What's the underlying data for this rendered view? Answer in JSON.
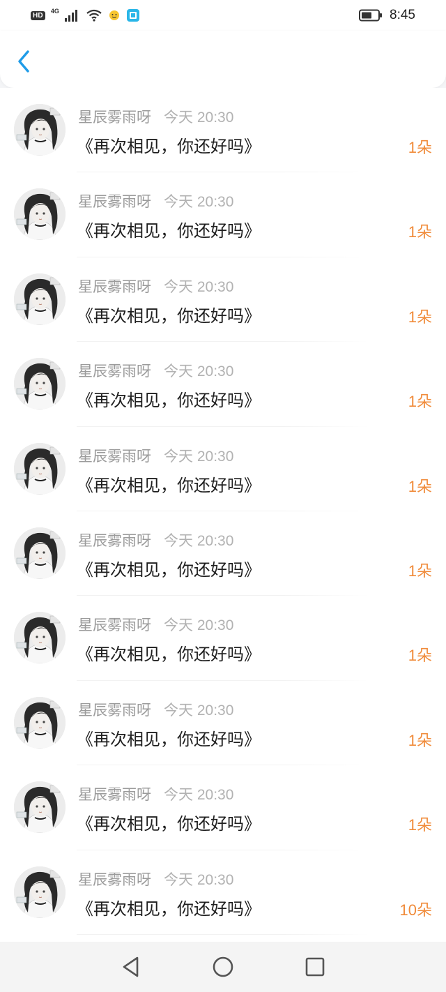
{
  "status_bar": {
    "hd_label": "HD",
    "network_label": "4G",
    "time": "8:45",
    "icons": [
      "signal-icon",
      "wifi-icon",
      "emoji-app-icon",
      "reader-app-icon",
      "battery-icon"
    ]
  },
  "header": {
    "back_icon": "chevron-left-icon",
    "accent_color": "#1e9be8"
  },
  "items": [
    {
      "username": "星辰雾雨呀",
      "time": "今天 20:30",
      "title": "《再次相见，你还好吗》",
      "count": "1朵"
    },
    {
      "username": "星辰雾雨呀",
      "time": "今天 20:30",
      "title": "《再次相见，你还好吗》",
      "count": "1朵"
    },
    {
      "username": "星辰雾雨呀",
      "time": "今天 20:30",
      "title": "《再次相见，你还好吗》",
      "count": "1朵"
    },
    {
      "username": "星辰雾雨呀",
      "time": "今天 20:30",
      "title": "《再次相见，你还好吗》",
      "count": "1朵"
    },
    {
      "username": "星辰雾雨呀",
      "time": "今天 20:30",
      "title": "《再次相见，你还好吗》",
      "count": "1朵"
    },
    {
      "username": "星辰雾雨呀",
      "time": "今天 20:30",
      "title": "《再次相见，你还好吗》",
      "count": "1朵"
    },
    {
      "username": "星辰雾雨呀",
      "time": "今天 20:30",
      "title": "《再次相见，你还好吗》",
      "count": "1朵"
    },
    {
      "username": "星辰雾雨呀",
      "time": "今天 20:30",
      "title": "《再次相见，你还好吗》",
      "count": "1朵"
    },
    {
      "username": "星辰雾雨呀",
      "time": "今天 20:30",
      "title": "《再次相见，你还好吗》",
      "count": "1朵"
    },
    {
      "username": "星辰雾雨呀",
      "time": "今天 20:30",
      "title": "《再次相见，你还好吗》",
      "count": "10朵"
    }
  ],
  "nav_bar": {
    "icons": [
      "back-triangle-icon",
      "home-circle-icon",
      "recents-square-icon"
    ]
  },
  "colors": {
    "count_orange": "#f08b3a",
    "username_gray": "#9b9b9b",
    "title_black": "#1f1f1f"
  }
}
